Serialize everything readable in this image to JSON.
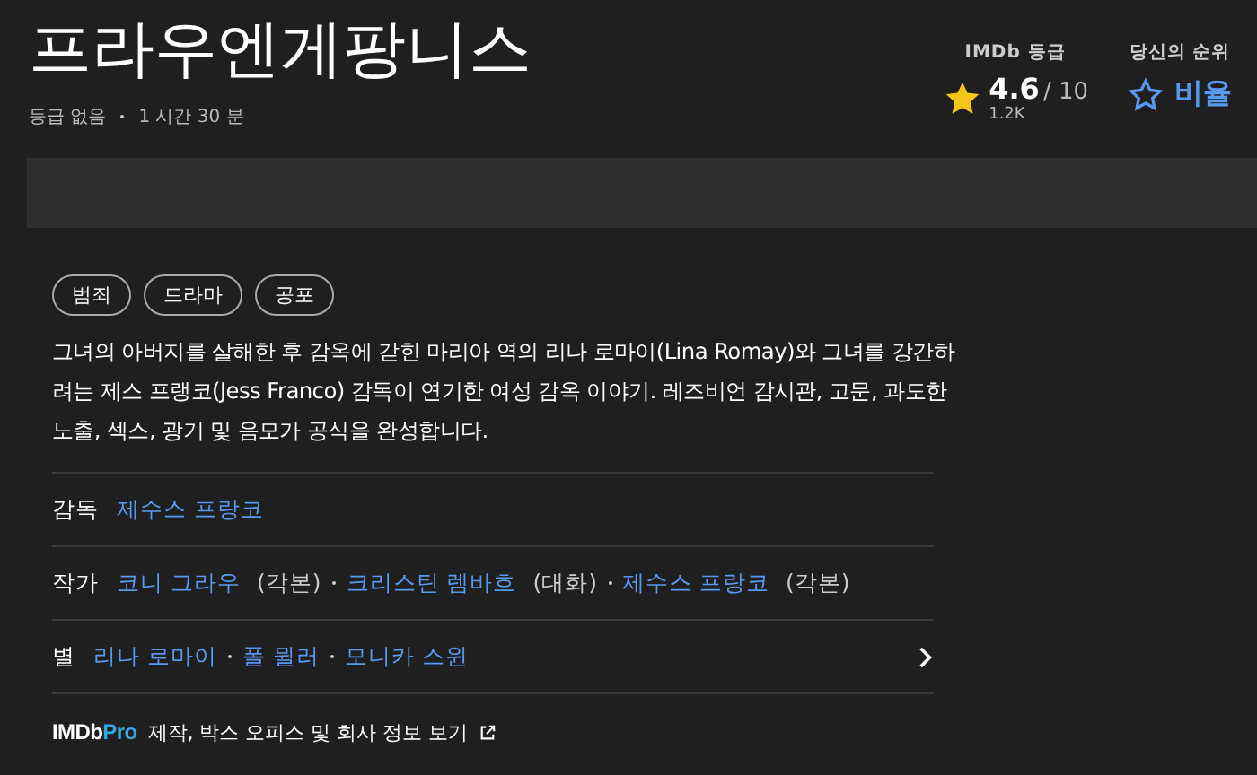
{
  "title": "프라우엔게팡니스",
  "meta": [
    "등급 없음",
    "1 시간 30 분"
  ],
  "imdb_rating": {
    "label": "IMDb 등급",
    "score": "4.6",
    "scale": "/ 10",
    "votes": "1.2K"
  },
  "your_rating": {
    "label": "당신의 순위",
    "action": "비율"
  },
  "genres": [
    "범죄",
    "드라마",
    "공포"
  ],
  "plot": "그녀의 아버지를 살해한 후 감옥에 갇힌 마리아 역의 리나 로마이(Lina Romay)와 그녀를 강간하려는 제스 프랭코(Jess Franco) 감독이 연기한 여성 감옥 이야기. 레즈비언 감시관, 고문, 과도한 노출, 섹스, 광기 및 음모가 공식을 완성합니다.",
  "credits": [
    {
      "label": "감독",
      "more": false,
      "people": [
        {
          "name": "제수스 프랑코"
        }
      ]
    },
    {
      "label": "작가",
      "more": false,
      "people": [
        {
          "name": "코니 그라우",
          "note": "(각본)"
        },
        {
          "name": "크리스틴 렘바흐",
          "note": "(대화)"
        },
        {
          "name": "제수스 프랑코",
          "note": "(각본)"
        }
      ]
    },
    {
      "label": "별",
      "more": true,
      "people": [
        {
          "name": "리나 로마이"
        },
        {
          "name": "폴 뮐러"
        },
        {
          "name": "모니카 스윈"
        }
      ]
    }
  ],
  "pro": {
    "logo_main": "IMDb",
    "logo_pro": "Pro",
    "link": "제작, 박스 오피스 및 회사 정보 보기"
  }
}
